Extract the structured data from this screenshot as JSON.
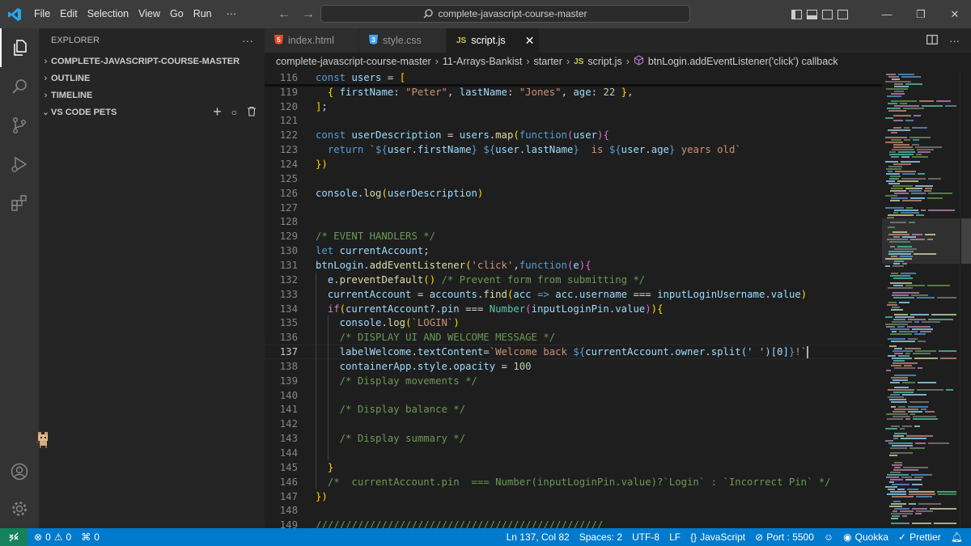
{
  "menu": [
    "File",
    "Edit",
    "Selection",
    "View",
    "Go",
    "Run",
    "···"
  ],
  "search": {
    "text": "complete-javascript-course-master"
  },
  "sidebar": {
    "title": "EXPLORER",
    "more": "···",
    "sections": [
      {
        "label": "COMPLETE-JAVASCRIPT-COURSE-MASTER",
        "expanded": false
      },
      {
        "label": "OUTLINE",
        "expanded": false
      },
      {
        "label": "TIMELINE",
        "expanded": false
      },
      {
        "label": "VS CODE PETS",
        "expanded": true
      }
    ]
  },
  "tabs": [
    {
      "icon": "5",
      "label": "index.html",
      "active": false,
      "icon_color": "#e44d26"
    },
    {
      "icon": "3",
      "label": "style.css",
      "active": false,
      "icon_color": "#42a5f5"
    },
    {
      "icon": "JS",
      "label": "script.js",
      "active": true,
      "icon_color": "#cbcb41"
    }
  ],
  "tab_actions": {
    "more": "···"
  },
  "breadcrumb": {
    "parts": [
      "complete-javascript-course-master",
      "11-Arrays-Bankist",
      "starter"
    ],
    "file": "script.js",
    "file_icon": "JS",
    "symbol": "btnLogin.addEventListener('click') callback"
  },
  "editor": {
    "current_line": "137",
    "lines": [
      {
        "n": "116",
        "text": "const users = ["
      },
      {
        "n": "119",
        "text": "  { firstName: \"Peter\", lastName: \"Jones\", age: 22 },"
      },
      {
        "n": "120",
        "text": "];"
      },
      {
        "n": "121",
        "text": ""
      },
      {
        "n": "122",
        "text": "const userDescription = users.map(function(user){"
      },
      {
        "n": "123",
        "text": "  return `${user.firstName} ${user.lastName}  is ${user.age} years old`"
      },
      {
        "n": "124",
        "text": "})"
      },
      {
        "n": "125",
        "text": ""
      },
      {
        "n": "126",
        "text": "console.log(userDescription)"
      },
      {
        "n": "127",
        "text": ""
      },
      {
        "n": "128",
        "text": ""
      },
      {
        "n": "129",
        "text": "/* EVENT HANDLERS */"
      },
      {
        "n": "130",
        "text": "let currentAccount;"
      },
      {
        "n": "131",
        "text": "btnLogin.addEventListener('click',function(e){"
      },
      {
        "n": "132",
        "text": "  e.preventDefault() /* Prevent form from submitting */"
      },
      {
        "n": "133",
        "text": "  currentAccount = accounts.find(acc => acc.username === inputLoginUsername.value)"
      },
      {
        "n": "134",
        "text": "  if(currentAccount?.pin === Number(inputLoginPin.value)){"
      },
      {
        "n": "135",
        "text": "    console.log(`LOGIN`)"
      },
      {
        "n": "136",
        "text": "    /* DISPLAY UI AND WELCOME MESSAGE */"
      },
      {
        "n": "137",
        "text": "    labelWelcome.textContent=`Welcome back ${currentAccount.owner.split(' ')[0]}!`"
      },
      {
        "n": "138",
        "text": "    containerApp.style.opacity = 100"
      },
      {
        "n": "139",
        "text": "    /* Display movements */"
      },
      {
        "n": "140",
        "text": ""
      },
      {
        "n": "141",
        "text": "    /* Display balance */"
      },
      {
        "n": "142",
        "text": ""
      },
      {
        "n": "143",
        "text": "    /* Display summary */"
      },
      {
        "n": "144",
        "text": ""
      },
      {
        "n": "145",
        "text": "  }"
      },
      {
        "n": "146",
        "text": "  /*  currentAccount.pin  === Number(inputLoginPin.value)?`Login` : `Incorrect Pin` */"
      },
      {
        "n": "147",
        "text": "})"
      },
      {
        "n": "148",
        "text": ""
      },
      {
        "n": "149",
        "text": "////////////////////////////////////////////////"
      }
    ]
  },
  "status": {
    "errors": "0",
    "warnings": "0",
    "ports": "0",
    "position": "Ln 137, Col 82",
    "spaces": "Spaces: 2",
    "encoding": "UTF-8",
    "eol": "LF",
    "language": "JavaScript",
    "port": "Port : 5500",
    "quokka": "Quokka",
    "prettier": "Prettier"
  },
  "colors": {
    "accent": "#007acc",
    "remote": "#16825d",
    "titlebar": "#3c3c3c",
    "editor_bg": "#1e1e1e"
  }
}
